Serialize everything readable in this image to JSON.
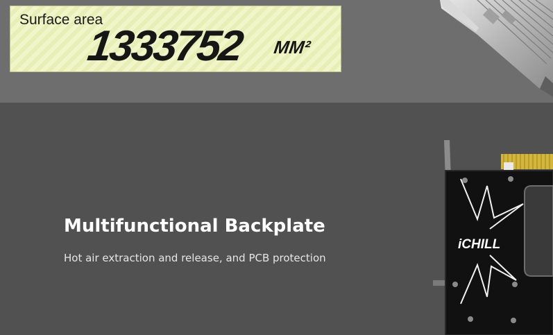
{
  "surface": {
    "label": "Surface area",
    "value": "1333752",
    "unit": "MM²"
  },
  "backplate": {
    "title": "Multifunctional Backplate",
    "subtitle": "Hot air extraction and release, and PCB protection"
  },
  "gpu": {
    "brand_text": "iCHILL"
  },
  "colors": {
    "top_band": "#6e6e6e",
    "main_background": "#515151",
    "card_background": "#f1f6c8",
    "title_text": "#ffffff"
  }
}
